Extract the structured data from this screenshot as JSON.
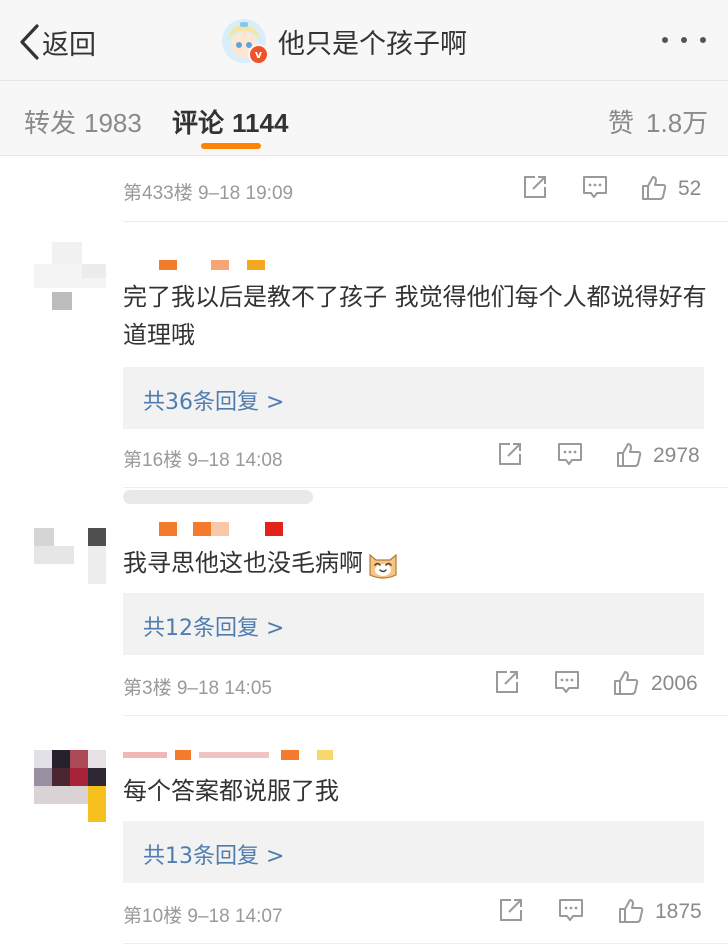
{
  "nav": {
    "back_label": "返回",
    "title": "他只是个孩子啊",
    "badge": "v"
  },
  "tabs": [
    {
      "label": "转发",
      "count": "1983"
    },
    {
      "label": "评论",
      "count": "1144"
    },
    {
      "label": "赞",
      "count": "1.8万"
    }
  ],
  "tab_active_index": 1,
  "accent_color": "#ff8200",
  "link_color": "#507daf",
  "prev_comment": {
    "floor": "第433楼",
    "time": "9–18 19:09",
    "likes": "52"
  },
  "comments": [
    {
      "text": "完了我以后是教不了孩子 我觉得他们每个人都说得好有道理哦",
      "replies": "共36条回复 >",
      "floor": "第16楼",
      "time": "9–18 14:08",
      "likes": "2978"
    },
    {
      "text": "我寻思他这也没毛病啊",
      "emoji": "cat-face-emoji",
      "replies": "共12条回复 >",
      "floor": "第3楼",
      "time": "9–18 14:05",
      "likes": "2006"
    },
    {
      "text": "每个答案都说服了我",
      "replies": "共13条回复 >",
      "floor": "第10楼",
      "time": "9–18 14:07",
      "likes": "1875"
    }
  ],
  "icons": {
    "back": "chevron-left-icon",
    "more": "more-dots-icon",
    "share": "share-icon",
    "comment": "comment-icon",
    "like": "thumbs-up-icon"
  }
}
